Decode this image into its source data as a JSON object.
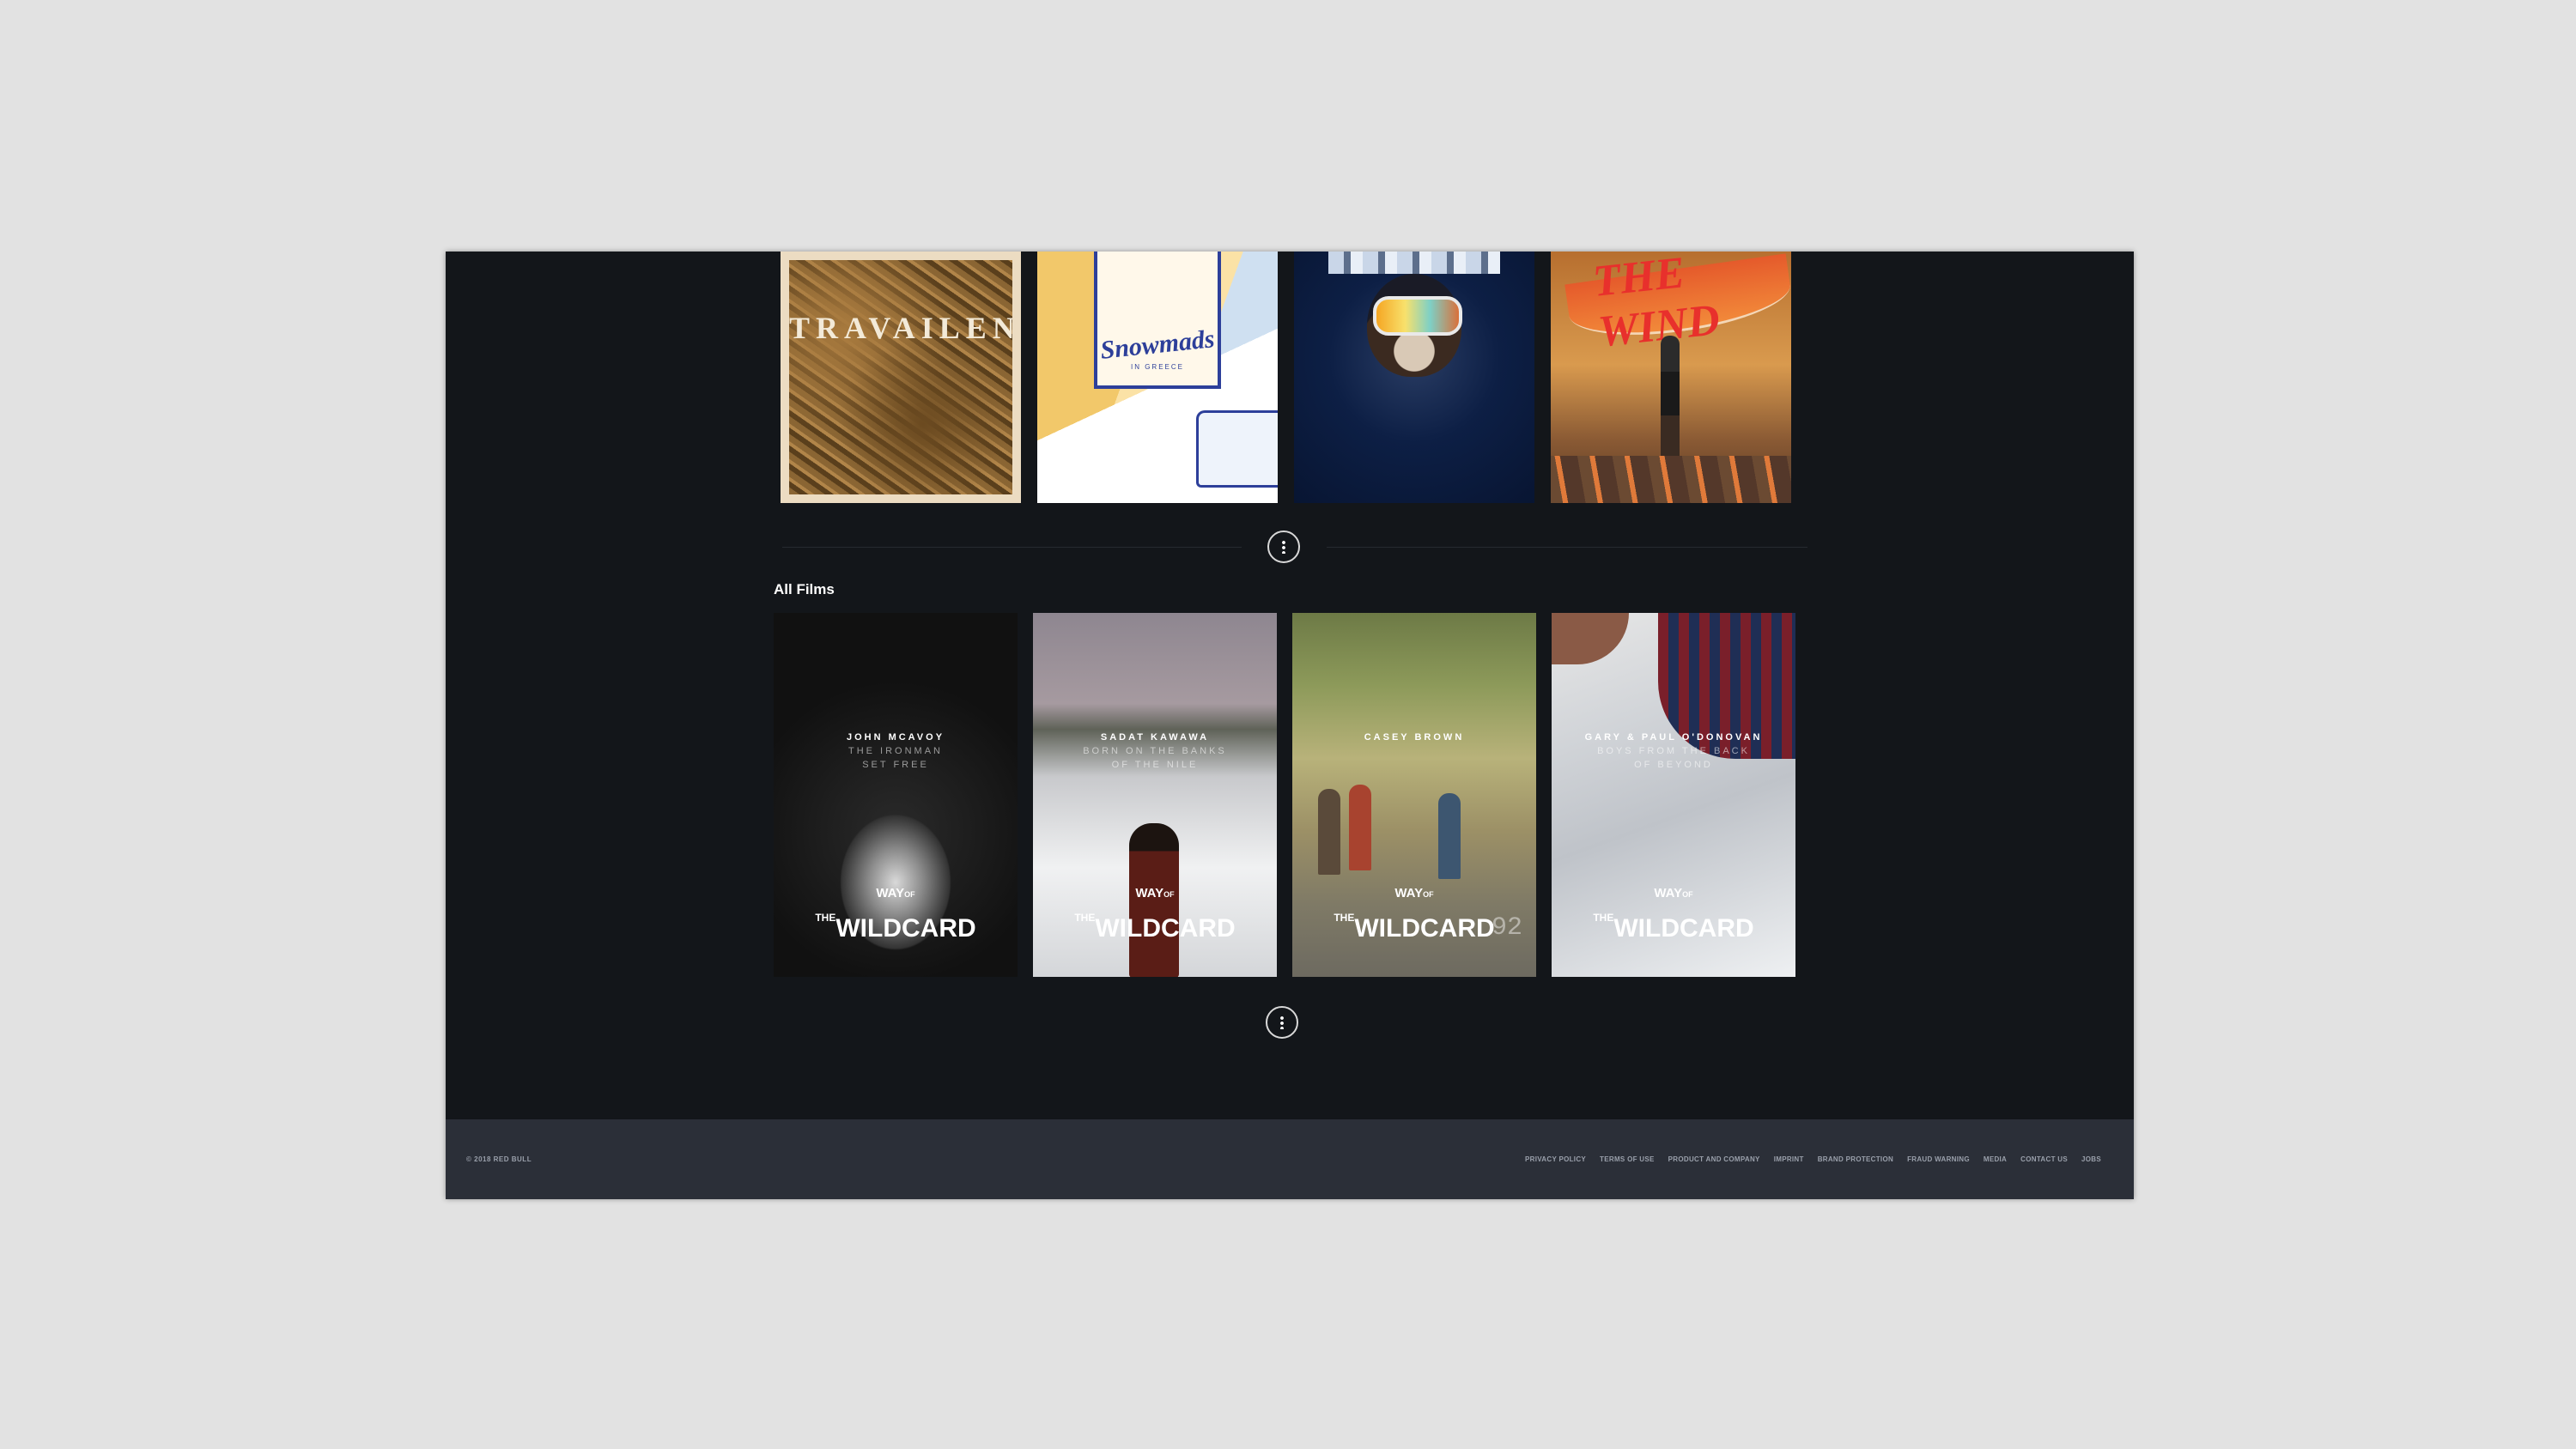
{
  "featured_row": {
    "posters": [
      {
        "title": "TRAVAILEN"
      },
      {
        "title": "Snowmads",
        "subtitle": "IN GREECE"
      },
      {
        "title": ""
      },
      {
        "title": "THE WIND"
      }
    ]
  },
  "all_films": {
    "section_title": "All Films",
    "films": [
      {
        "person": "JOHN MCAVOY",
        "tagline_1": "THE IRONMAN",
        "tagline_2": "SET FREE",
        "logo_small": "THE",
        "logo_way": "WAY",
        "logo_of": "OF",
        "logo_big": "WILDCARD"
      },
      {
        "person": "SADAT KAWAWA",
        "tagline_1": "BORN ON THE BANKS",
        "tagline_2": "OF THE NILE",
        "logo_small": "THE",
        "logo_way": "WAY",
        "logo_of": "OF",
        "logo_big": "WILDCARD"
      },
      {
        "person": "CASEY BROWN",
        "tagline_1": "",
        "tagline_2": "",
        "logo_small": "THE",
        "logo_way": "WAY",
        "logo_of": "OF",
        "logo_big": "WILDCARD",
        "overlay_number": "92"
      },
      {
        "person": "GARY & PAUL O'DONOVAN",
        "tagline_1": "BOYS FROM THE BACK",
        "tagline_2": "OF BEYOND",
        "logo_small": "THE",
        "logo_way": "WAY",
        "logo_of": "OF",
        "logo_big": "WILDCARD"
      }
    ]
  },
  "footer": {
    "copyright": "© 2018 RED BULL",
    "links": [
      "PRIVACY POLICY",
      "TERMS OF USE",
      "PRODUCT AND COMPANY",
      "IMPRINT",
      "BRAND PROTECTION",
      "FRAUD WARNING",
      "MEDIA",
      "CONTACT US",
      "JOBS"
    ]
  },
  "icons": {
    "more": "vertical-dots-icon"
  }
}
